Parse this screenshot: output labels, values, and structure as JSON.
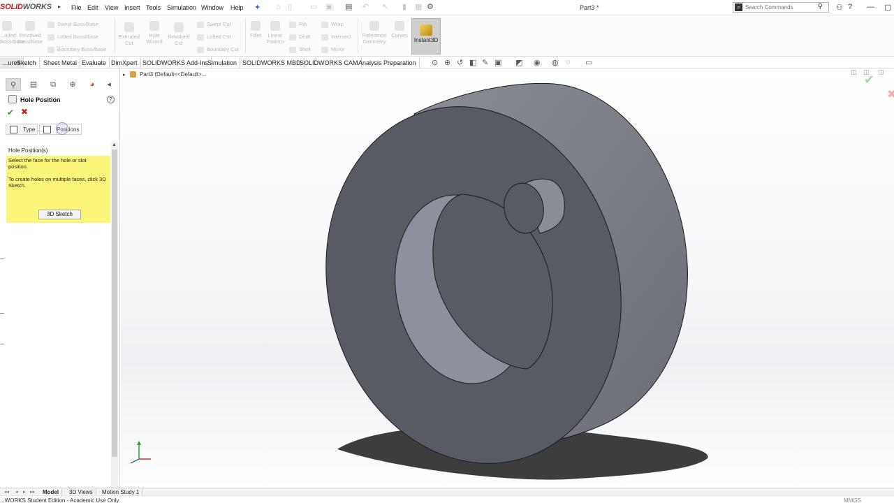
{
  "app": {
    "logo_solid": "SOLID",
    "logo_works": "WORKS",
    "document_title": "Part3 *"
  },
  "menu": [
    "File",
    "Edit",
    "View",
    "Insert",
    "Tools",
    "Simulation",
    "Window",
    "Help"
  ],
  "search": {
    "placeholder": "Search Commands"
  },
  "ribbon": {
    "extruded_boss": "...uded\nBoss/Base",
    "revolved_boss": "Revolved\nBoss/Base",
    "swept_boss": "Swept Boss/Base",
    "lofted_boss": "Lofted Boss/Base",
    "boundary_boss": "Boundary Boss/Base",
    "extruded_cut": "Extruded\nCut",
    "hole_wizard": "Hole\nWizard",
    "revolved_cut": "Revolved\nCut",
    "swept_cut": "Swept Cut",
    "lofted_cut": "Lofted Cut",
    "boundary_cut": "Boundary Cut",
    "fillet": "Fillet",
    "linear_pattern": "Linear\nPattern",
    "rib": "Rib",
    "draft": "Draft",
    "shell": "Shell",
    "wrap": "Wrap",
    "intersect": "Intersect",
    "mirror": "Mirror",
    "reference_geometry": "Reference\nGeometry",
    "curves": "Curves",
    "instant3d": "Instant3D"
  },
  "command_tabs": [
    "...ures",
    "Sketch",
    "Sheet Metal",
    "Evaluate",
    "DimXpert",
    "SOLIDWORKS Add-Ins",
    "Simulation",
    "SOLIDWORKS MBD",
    "SOLIDWORKS CAM",
    "Analysis Preparation"
  ],
  "property_manager": {
    "title": "Hole Position",
    "help": "?",
    "tabs": {
      "type": "Type",
      "positions": "Positions"
    },
    "group_title": "Hole Position(s)",
    "message_1": "Select the face for the hole or slot position.",
    "message_2": "To create holes on multiple faces, click 3D Sketch.",
    "sketch_button": "3D Sketch"
  },
  "feature_tree": {
    "root": "Part3  (Default<<Default>..."
  },
  "bottom_tabs": [
    "Model",
    "3D Views",
    "Motion Study 1"
  ],
  "status": {
    "text": "...WORKS Student Edition - Academic Use Only",
    "units": "MMGS"
  },
  "colors": {
    "brand_red": "#d0161c",
    "model_face": "#5b5d66",
    "model_side": "#7b7d88",
    "message_bg": "#fbf57a"
  },
  "icons": [
    "search-icon",
    "help-icon",
    "user-icon",
    "pin-icon",
    "home-icon",
    "new-icon",
    "open-icon",
    "save-icon",
    "print-icon",
    "undo-icon",
    "select-icon",
    "rebuild-icon",
    "options-icon",
    "feature-manager-icon",
    "property-manager-icon",
    "configuration-manager-icon",
    "dimxpert-icon",
    "display-manager-icon",
    "check-icon",
    "close-icon",
    "triad-icon"
  ]
}
